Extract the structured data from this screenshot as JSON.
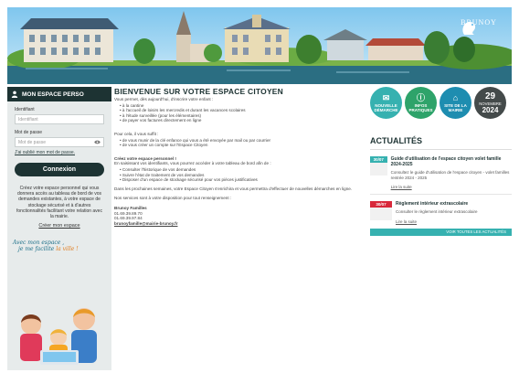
{
  "brand": {
    "name": "BRUNOY"
  },
  "sidebar": {
    "heading": "MON ESPACE PERSO",
    "id_label": "Identifiant",
    "id_placeholder": "Identifiant",
    "pwd_label": "Mot de passe",
    "pwd_placeholder": "Mot de passe",
    "forgot": "J'ai oublié mon mot de passe.",
    "connect": "Connexion",
    "info": "Créez votre espace personnel qui vous donnera accès au tableau de bord de vos demandes existantes, à votre espace de stockage sécurisé et à d'autres fonctionnalités facilitant votre relation avec la mairie.",
    "create": "Créer mon espace",
    "slogan_1": "Avec mon espace ,",
    "slogan_2a": "je me facilite ",
    "slogan_2b": "la ville !"
  },
  "main": {
    "title": "BIENVENUE SUR VOTRE ESPACE CITOYEN",
    "intro": "Vous permet, dès aujourd'hui, d'inscrire votre enfant :",
    "list1": [
      "à la cantine",
      "à l'accueil de loisirs les mercredis et durant les vacances scolaires",
      "à l'étude surveillée (pour les élémentaires)",
      "de payer vos factures directement en ligne"
    ],
    "suffice": "Pour cela, il vous suffit :",
    "list2": [
      "de vous munir de la clé enfance qui vous a été envoyée par mail ou par courrier",
      "de vous créer un compte sur l'Espace Citoyen"
    ],
    "created_q": "Créez votre espace personnel !",
    "created_t": "En saisissant vos identifiants, vous pourrez accéder à votre tableau de bord afin de :",
    "list3": [
      "Consulter l'historique de vos demandes",
      "Suivre l'état de traitement de vos demandes",
      "Disposer d'un espace de stockage sécurisé pour vos pièces justificatives"
    ],
    "future": "Dans les prochaines semaines, votre Espace Citoyen s'enrichira et vous permettra d'effectuer de nouvelles démarches en ligne.",
    "contact_intro": "Nos services sont à votre disposition pour tout renseignement :",
    "contact_name": "Brunoy Familles",
    "phone1": "01.69.39.89.70",
    "phone2": "01.69.39.97.84",
    "email": "brunoyfamille@mairie-brunoy.fr"
  },
  "quick": [
    {
      "label": "NOUVELLE DÉMARCHE",
      "icon": "document-icon",
      "color": "#36b1b0"
    },
    {
      "label": "INFOS PRATIQUES",
      "icon": "info-icon",
      "color": "#2ea36a"
    },
    {
      "label": "SITE DE LA MAIRIE",
      "icon": "home-icon",
      "color": "#1e8db0"
    }
  ],
  "date": {
    "day": "29",
    "month": "NOVEMBRE",
    "year": "2024"
  },
  "news": {
    "title": "ACTUALITÉS",
    "items": [
      {
        "date": "30/07",
        "title": "Guide d'utilisation de l'espace citoyen volet famille 2024-2025",
        "desc": "Consultez le guide d'utilisation de l'espace citoyen - volet familles rentrée 2024 - 2025",
        "more": "Lire la suite"
      },
      {
        "date": "30/07",
        "title": "Règlement intérieur extrascolaire",
        "desc": "Consulter le règlement intérieur extrascolaire",
        "more": "Lire la suite"
      }
    ],
    "all": "VOIR TOUTES LES ACTUALITÉS"
  }
}
